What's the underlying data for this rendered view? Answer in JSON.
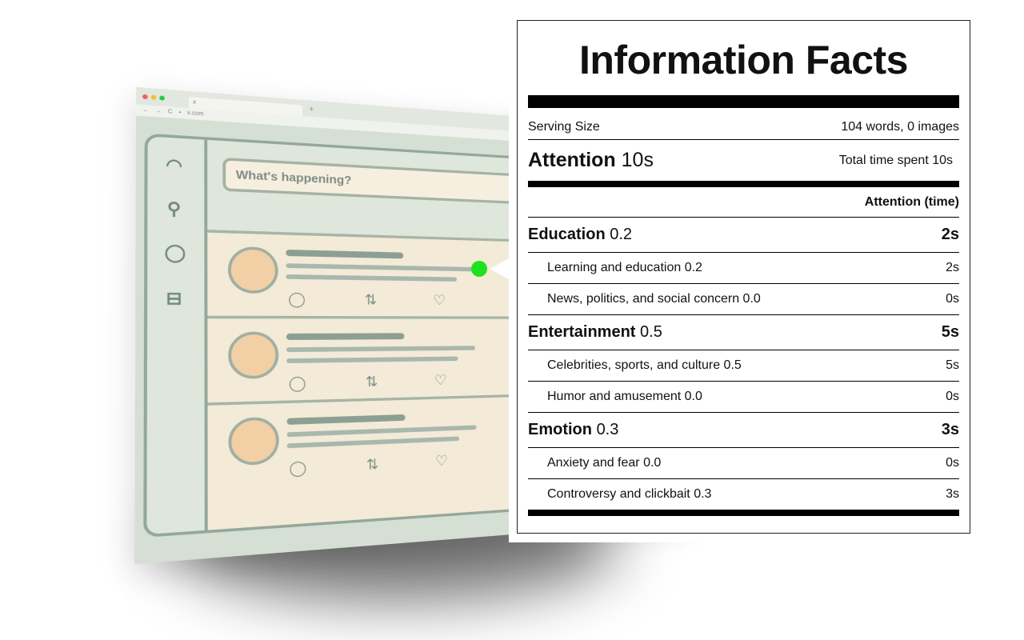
{
  "browser": {
    "tab_title": "x",
    "new_tab": "+",
    "url": "x.com",
    "compose_placeholder": "What's happening?",
    "dot_colors": [
      "#f25f57",
      "#f7bd2f",
      "#28c840"
    ]
  },
  "facts": {
    "title": "Information Facts",
    "serving": {
      "label": "Serving Size",
      "value": "104 words, 0 images"
    },
    "attention": {
      "label": "Attention",
      "value": "10s",
      "total": "Total time spent 10s"
    },
    "column_header": "Attention (time)",
    "categories": [
      {
        "name": "Education",
        "score": "0.2",
        "time": "2s",
        "items": [
          {
            "label": "Learning and education 0.2",
            "time": "2s"
          },
          {
            "label": "News, politics, and social concern 0.0",
            "time": "0s"
          }
        ]
      },
      {
        "name": "Entertainment",
        "score": "0.5",
        "time": "5s",
        "items": [
          {
            "label": "Celebrities, sports, and culture 0.5",
            "time": "5s"
          },
          {
            "label": "Humor and amusement 0.0",
            "time": "0s"
          }
        ]
      },
      {
        "name": "Emotion",
        "score": "0.3",
        "time": "3s",
        "items": [
          {
            "label": "Anxiety and fear 0.0",
            "time": "0s"
          },
          {
            "label": "Controversy and clickbait 0.3",
            "time": "3s"
          }
        ]
      }
    ]
  },
  "icons": {
    "home": "home-icon",
    "search": "search-icon",
    "messages": "chat-icon",
    "lists": "list-icon",
    "reply": "reply-icon",
    "retweet": "retweet-icon",
    "like": "heart-icon"
  },
  "colors": {
    "marker": "#1fe21f",
    "frame": "#93a89a",
    "feed": "#f4ead8",
    "avatar": "#f3cfa6"
  }
}
